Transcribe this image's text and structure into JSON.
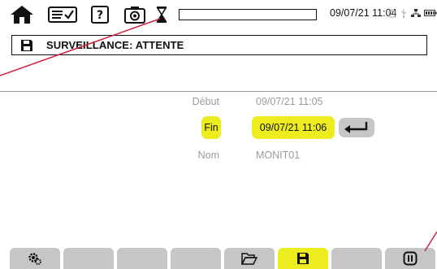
{
  "statusbar": {
    "datetime": "09/07/21 11:04",
    "icons": [
      "home-icon",
      "event-list-icon",
      "help-icon",
      "camera-icon",
      "hourglass-icon",
      "recording-icon",
      "usb-icon",
      "network-icon",
      "battery-icon"
    ],
    "progress": 0
  },
  "header": {
    "icon": "save-icon",
    "title": "SURVEILLANCE: ATTENTE"
  },
  "form": {
    "debut": {
      "label": "Début",
      "value": "09/07/21 11:05"
    },
    "fin": {
      "label": "Fin",
      "value": "09/07/21 11:06"
    },
    "nom": {
      "label": "Nom",
      "value": "MONIT01"
    }
  },
  "tabs": [
    {
      "icon": "settings-gear-icon",
      "active": false
    },
    {
      "icon": "",
      "active": false
    },
    {
      "icon": "",
      "active": false
    },
    {
      "icon": "",
      "active": false
    },
    {
      "icon": "open-folder-icon",
      "active": false
    },
    {
      "icon": "save-icon",
      "active": true
    },
    {
      "icon": "",
      "active": false
    },
    {
      "icon": "pause-icon",
      "active": false
    }
  ],
  "colors": {
    "highlight": "#ecec1e",
    "tab_inactive": "#c6c6c6",
    "annotation_line": "#d0203a",
    "text_dim": "#9a9a9a"
  }
}
